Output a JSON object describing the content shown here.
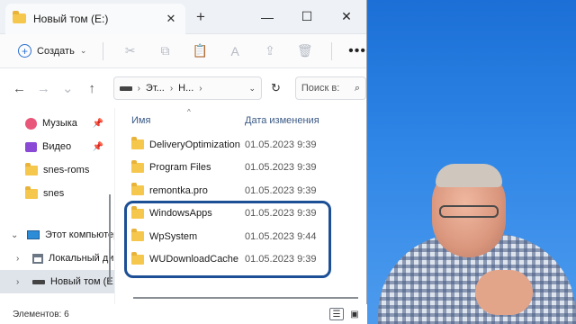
{
  "window": {
    "tab_title": "Новый том (E:)",
    "close_tab": "✕",
    "new_tab": "+",
    "minimize": "—",
    "maximize": "☐",
    "close": "✕"
  },
  "toolbar": {
    "create_label": "Создать",
    "more": "•••"
  },
  "address": {
    "segments": [
      "Эт...",
      "Н..."
    ],
    "search_placeholder": "Поиск в:"
  },
  "sidebar": {
    "items": [
      {
        "label": "Музыка",
        "icon": "music-icon",
        "pinned": true
      },
      {
        "label": "Видео",
        "icon": "video-icon",
        "pinned": true
      },
      {
        "label": "snes-roms",
        "icon": "folder-icon"
      },
      {
        "label": "snes",
        "icon": "folder-icon"
      },
      {
        "label": "Этот компьютер",
        "icon": "computer-icon",
        "expanded": true
      },
      {
        "label": "Локальный ди",
        "icon": "network-drive-icon"
      },
      {
        "label": "Новый том (E",
        "icon": "drive-icon",
        "selected": true
      }
    ]
  },
  "columns": {
    "name": "Имя",
    "date": "Дата изменения"
  },
  "files": [
    {
      "name": "DeliveryOptimization",
      "date": "01.05.2023 9:39"
    },
    {
      "name": "Program Files",
      "date": "01.05.2023 9:39"
    },
    {
      "name": "remontka.pro",
      "date": "01.05.2023 9:39"
    },
    {
      "name": "WindowsApps",
      "date": "01.05.2023 9:39"
    },
    {
      "name": "WpSystem",
      "date": "01.05.2023 9:44"
    },
    {
      "name": "WUDownloadCache",
      "date": "01.05.2023 9:39"
    }
  ],
  "status": {
    "count_text": "Элементов: 6"
  },
  "colors": {
    "accent": "#1c4f95",
    "folder": "#f6c74d",
    "background": "#2f86e6"
  }
}
